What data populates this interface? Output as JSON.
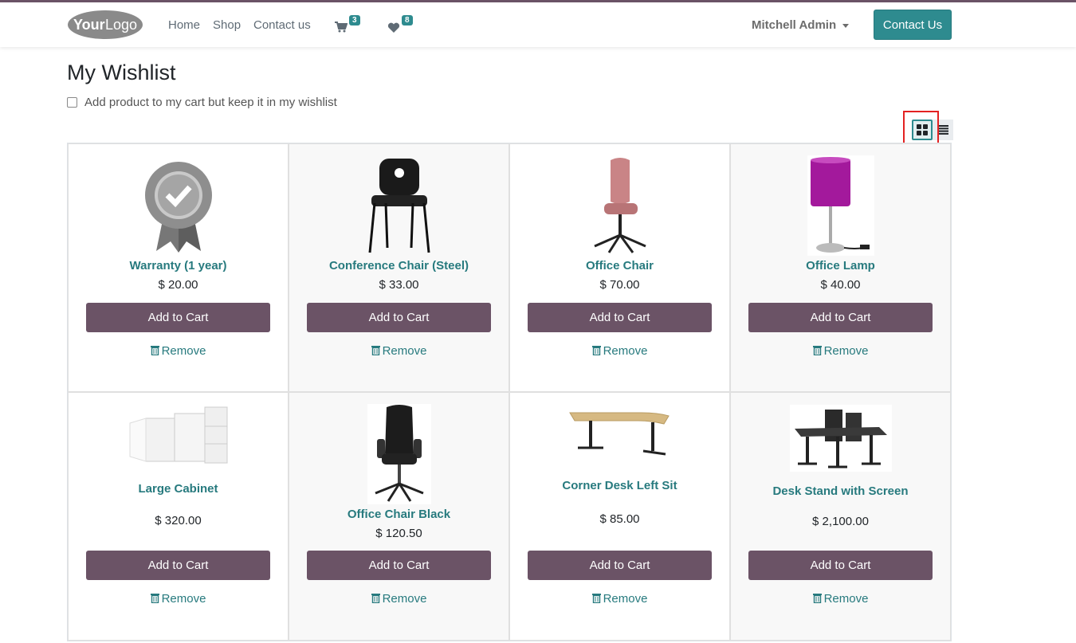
{
  "header": {
    "logo_text": "YourLogo",
    "nav": [
      "Home",
      "Shop",
      "Contact us"
    ],
    "cart_count": "3",
    "wishlist_count": "8",
    "user": "Mitchell Admin",
    "contact_button": "Contact Us"
  },
  "page": {
    "title": "My Wishlist",
    "keep_in_wishlist_label": "Add product to my cart but keep it in my wishlist"
  },
  "products": [
    {
      "name": "Warranty (1 year)",
      "price": "$ 20.00",
      "add": "Add to Cart",
      "remove": "Remove",
      "icon": "warranty-badge"
    },
    {
      "name": "Conference Chair (Steel)",
      "price": "$ 33.00",
      "add": "Add to Cart",
      "remove": "Remove",
      "icon": "conference-chair"
    },
    {
      "name": "Office Chair",
      "price": "$ 70.00",
      "add": "Add to Cart",
      "remove": "Remove",
      "icon": "office-chair"
    },
    {
      "name": "Office Lamp",
      "price": "$ 40.00",
      "add": "Add to Cart",
      "remove": "Remove",
      "icon": "office-lamp"
    },
    {
      "name": "Large Cabinet",
      "price": "$ 320.00",
      "add": "Add to Cart",
      "remove": "Remove",
      "icon": "cabinet"
    },
    {
      "name": "Office Chair Black",
      "price": "$ 120.50",
      "add": "Add to Cart",
      "remove": "Remove",
      "icon": "office-chair-black"
    },
    {
      "name": "Corner Desk Left Sit",
      "price": "$ 85.00",
      "add": "Add to Cart",
      "remove": "Remove",
      "icon": "corner-desk"
    },
    {
      "name": "Desk Stand with Screen",
      "price": "$ 2,100.00",
      "add": "Add to Cart",
      "remove": "Remove",
      "icon": "desk-with-screen"
    }
  ],
  "colors": {
    "brand": "#6b5366",
    "accent": "#2e8b8f"
  }
}
